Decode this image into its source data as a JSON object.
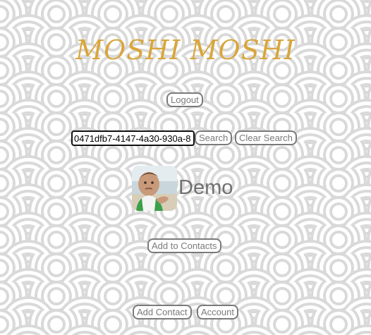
{
  "app": {
    "logo_text": "MOSHI MOSHI"
  },
  "header": {
    "logout_label": "Logout"
  },
  "search": {
    "value": "0471dfb7-4147-4a30-930a-8",
    "search_label": "Search",
    "clear_label": "Clear Search"
  },
  "profile": {
    "name": "Demo",
    "add_to_contacts_label": "Add to Contacts"
  },
  "footer": {
    "add_contact_label": "Add Contact",
    "account_label": "Account"
  },
  "colors": {
    "logo": "#d9a63a",
    "button_text": "#7a7a7a",
    "name_text": "#707070",
    "wave_stroke": "#d9d9d9"
  }
}
